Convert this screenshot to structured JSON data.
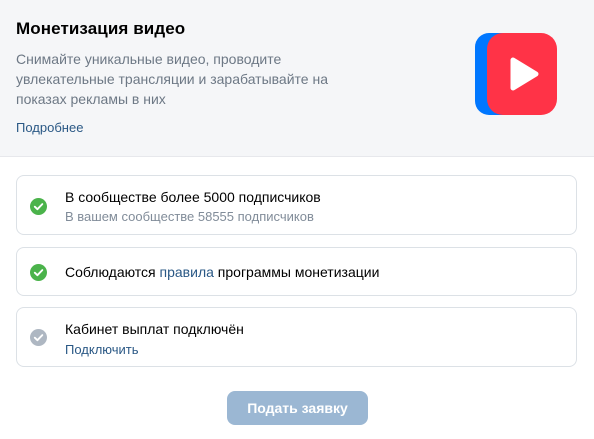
{
  "promo": {
    "title": "Монетизация видео",
    "description": "Снимайте уникальные видео, проводите увлекательные трансляции и зарабатывайте на показах рекламы в них",
    "more_link": "Подробнее",
    "logo_icon": "vk-video-play-icon"
  },
  "requirements": [
    {
      "title": "В сообществе более 5000 подписчиков",
      "subtitle": "В вашем сообществе 58555 подписчиков",
      "status": "done"
    },
    {
      "title_before": "Соблюдаются ",
      "title_link": "правила",
      "title_after": " программы монетизации",
      "status": "done"
    },
    {
      "title": "Кабинет выплат подключён",
      "action": "Подключить",
      "status": "pending"
    }
  ],
  "submit_button": {
    "label": "Подать заявку",
    "disabled": true
  },
  "colors": {
    "accent": "#2a5885",
    "success": "#4bb34b",
    "pending": "#aeb7c2",
    "button_disabled": "#9bb7d3",
    "logo_red": "#ff3347",
    "logo_blue": "#0077ff"
  }
}
